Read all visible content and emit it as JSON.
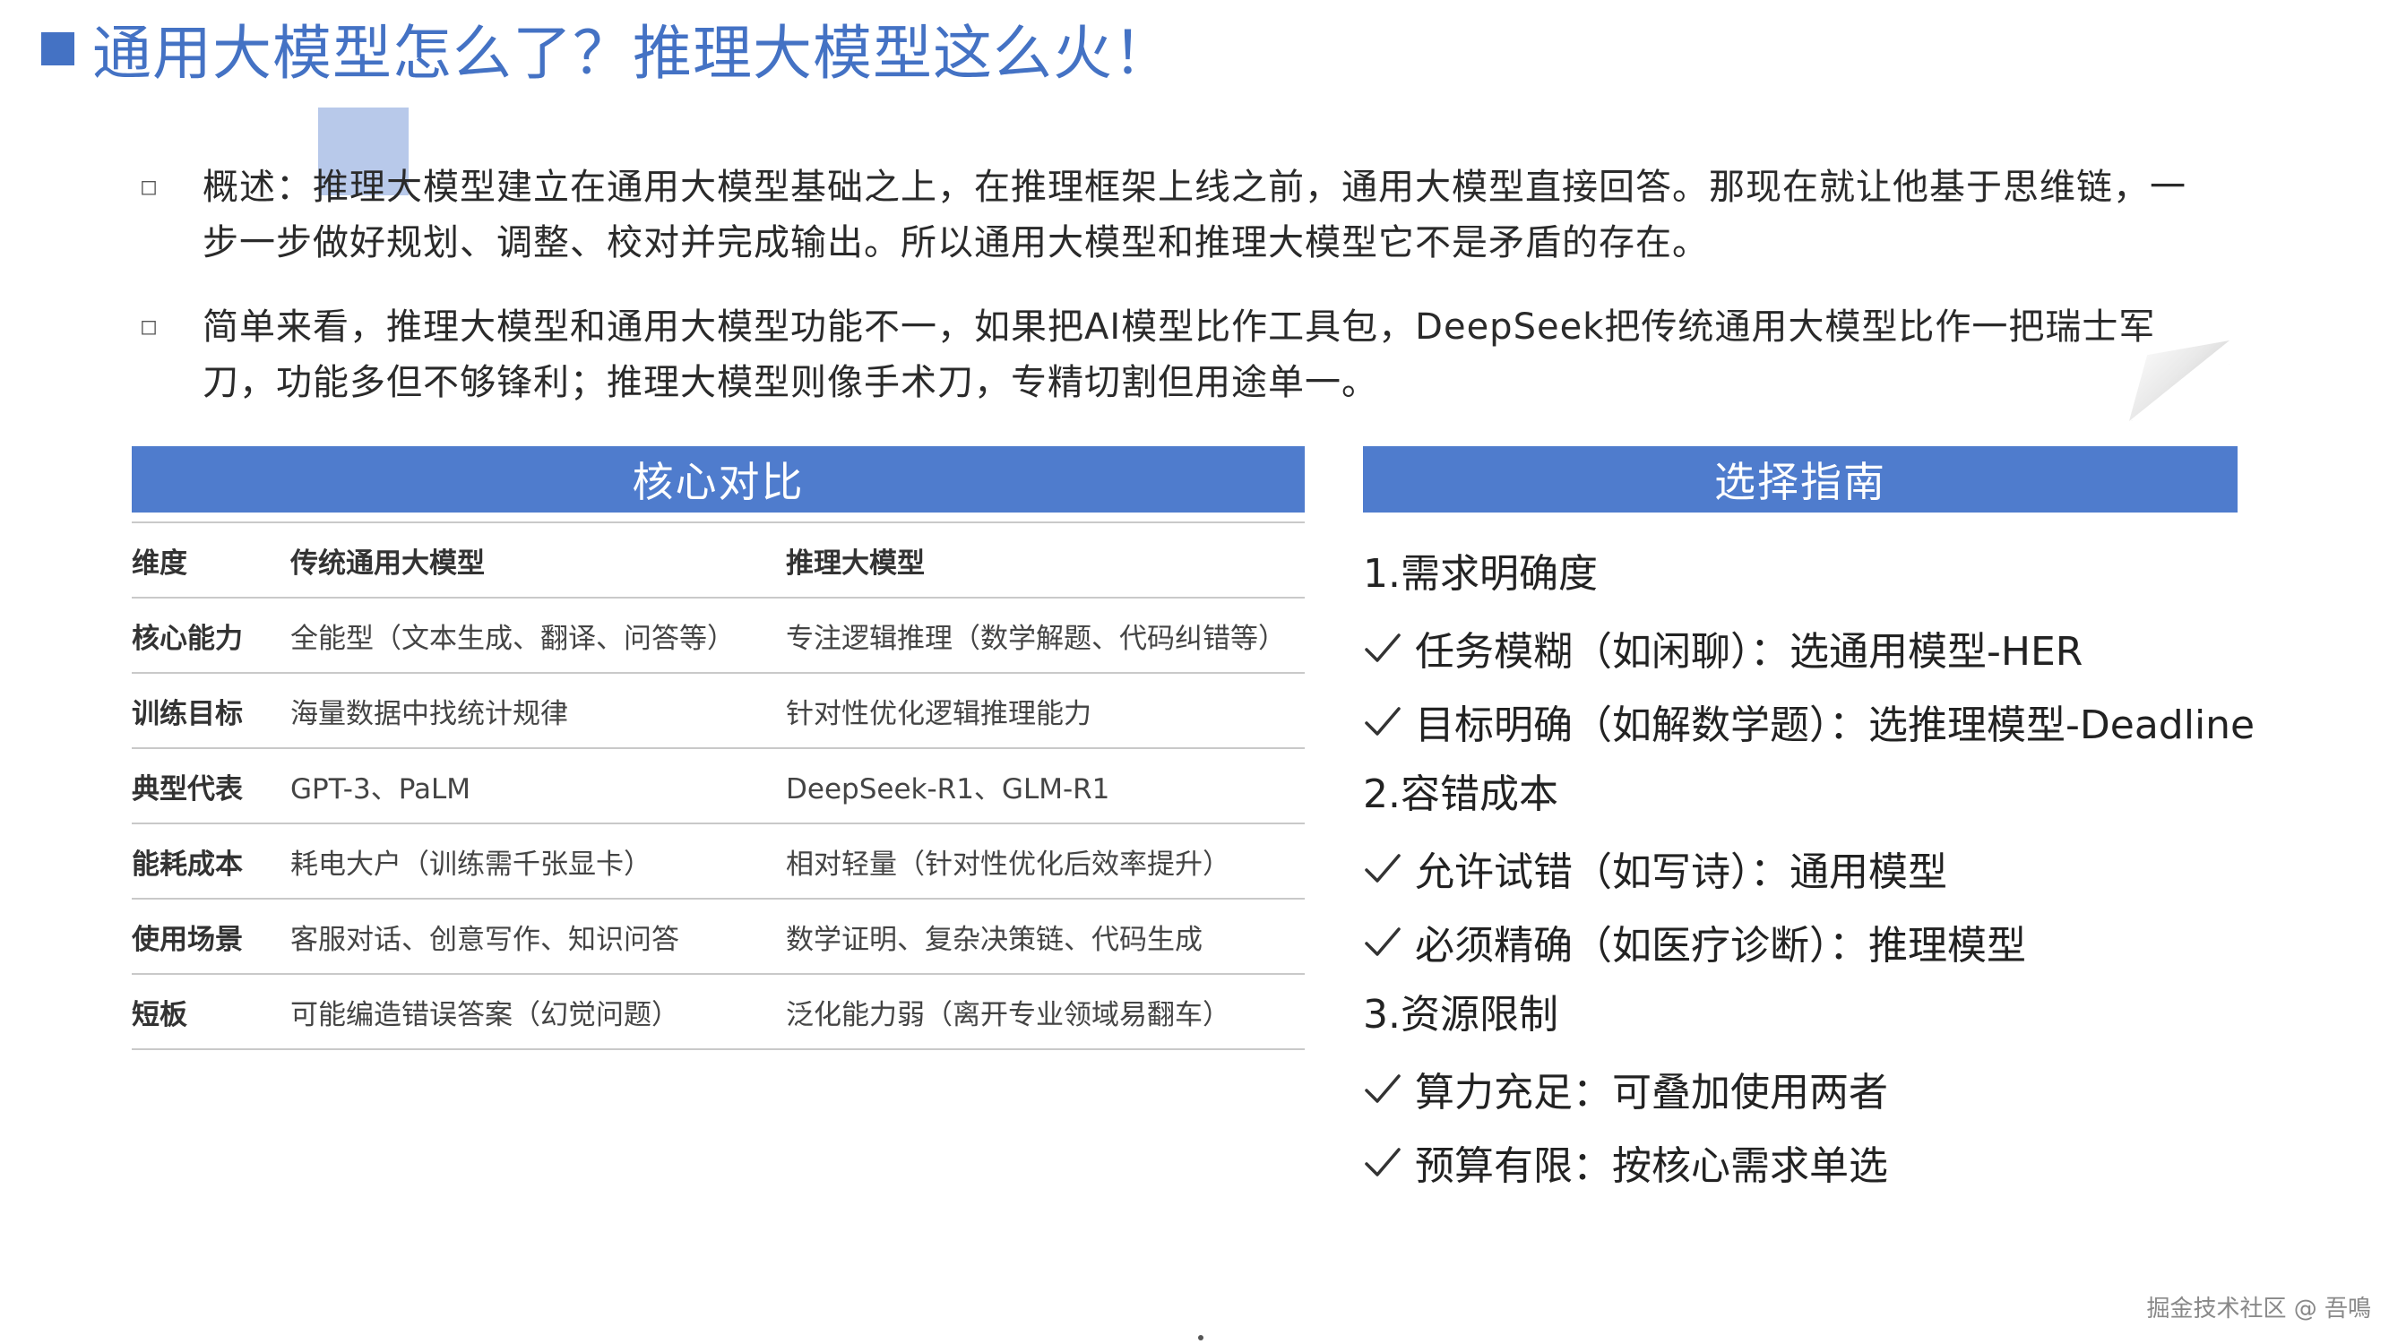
{
  "title": "通用大模型怎么了？推理大模型这么火！",
  "overview": {
    "bullet_glyph": "◻",
    "paragraphs": [
      "概述：推理大模型建立在通用大模型基础之上，在推理框架上线之前，通用大模型直接回答。那现在就让他基于思维链，一步一步做好规划、调整、校对并完成输出。所以通用大模型和推理大模型它不是矛盾的存在。",
      "简单来看，推理大模型和通用大模型功能不一，如果把AI模型比作工具包，DeepSeek把传统通用大模型比作一把瑞士军刀，功能多但不够锋利；推理大模型则像手术刀，专精切割但用途单一。"
    ]
  },
  "compare": {
    "header": "核心对比",
    "columns": [
      "维度",
      "传统通用大模型",
      "推理大模型"
    ],
    "rows": [
      [
        "核心能力",
        "全能型（文本生成、翻译、问答等）",
        "专注逻辑推理（数学解题、代码纠错等）"
      ],
      [
        "训练目标",
        "海量数据中找统计规律",
        "针对性优化逻辑推理能力"
      ],
      [
        "典型代表",
        "GPT-3、PaLM",
        "DeepSeek-R1、GLM-R1"
      ],
      [
        "能耗成本",
        "耗电大户（训练需千张显卡）",
        "相对轻量（针对性优化后效率提升）"
      ],
      [
        "使用场景",
        "客服对话、创意写作、知识问答",
        "数学证明、复杂决策链、代码生成"
      ],
      [
        "短板",
        "可能编造错误答案（幻觉问题）",
        "泛化能力弱（离开专业领域易翻车）"
      ]
    ]
  },
  "guide": {
    "header": "选择指南",
    "sections": [
      {
        "heading": "1.需求明确度",
        "items": [
          "任务模糊（如闲聊）：选通用模型-HER",
          "目标明确（如解数学题）：选推理模型-Deadline"
        ]
      },
      {
        "heading": "2.容错成本",
        "items": [
          "允许试错（如写诗）：通用模型",
          "必须精确（如医疗诊断）：推理模型"
        ]
      },
      {
        "heading": "3.资源限制",
        "items": [
          "算力充足：可叠加使用两者",
          "预算有限：按核心需求单选"
        ]
      }
    ]
  },
  "footer": {
    "watermark": "掘金技术社区 @ 吾鳴"
  },
  "colors": {
    "accent": "#4472c4",
    "header_bg": "#4f7ccd",
    "highlight": "#92acde"
  }
}
